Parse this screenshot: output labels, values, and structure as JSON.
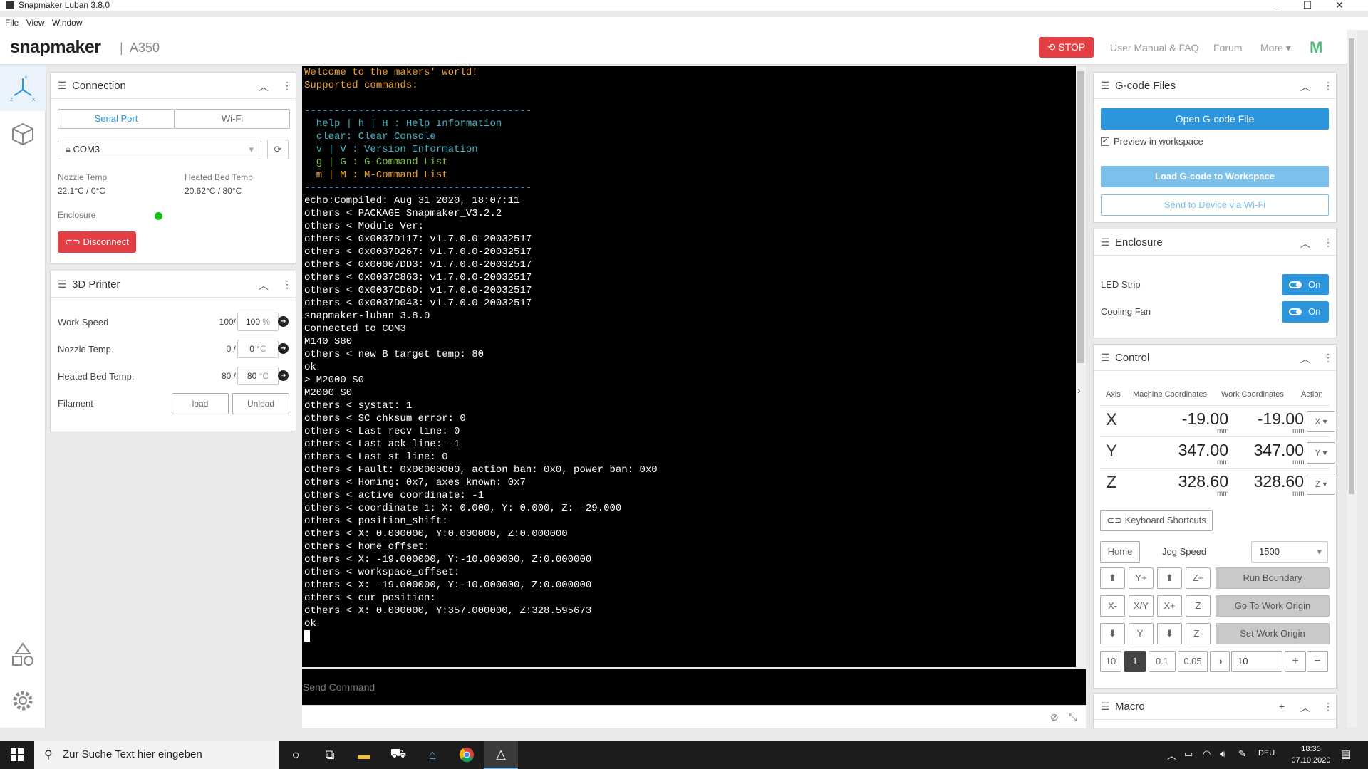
{
  "window": {
    "title": "Snapmaker Luban 3.8.0",
    "controls": [
      "–",
      "☐",
      "✕"
    ]
  },
  "menu": [
    "File",
    "View",
    "Window"
  ],
  "header": {
    "logo": "snapmaker",
    "separator": "|",
    "machine": "A350",
    "stop_label": "STOP",
    "links": [
      "User Manual & FAQ",
      "Forum",
      "More"
    ],
    "brand_mark": "M",
    "stop_color": "#e33f44"
  },
  "connection": {
    "title": "Connection",
    "tabs": [
      "Serial Port",
      "Wi-Fi"
    ],
    "port": "COM3",
    "nozzle_label": "Nozzle Temp",
    "nozzle_value": "22.1°C / 0°C",
    "bed_label": "Heated Bed Temp",
    "bed_value": "20.62°C / 80°C",
    "enclosure_label": "Enclosure",
    "disconnect_label": "Disconnect"
  },
  "printer": {
    "title": "3D Printer",
    "rows": [
      {
        "label": "Work Speed",
        "current": "100/",
        "target": "100",
        "unit": "%"
      },
      {
        "label": "Nozzle Temp.",
        "current": "0 /",
        "target": "0",
        "unit": "°C"
      },
      {
        "label": "Heated Bed Temp.",
        "current": "80 /",
        "target": "80",
        "unit": "°C"
      }
    ],
    "filament_label": "Filament",
    "load_label": "load",
    "unload_label": "Unload"
  },
  "console": {
    "lines": [
      {
        "text": "Welcome to the makers' world!",
        "color": "#f0a030"
      },
      {
        "text": "Supported commands:",
        "color": "#f0a030"
      },
      {
        "text": "",
        "color": "#fff"
      },
      {
        "text": "--------------------------------------",
        "color": "#3a8fd8"
      },
      {
        "text": "  help | h | H : Help Information",
        "color": "#3fb4c4"
      },
      {
        "text": "  clear: Clear Console",
        "color": "#3fb4c4"
      },
      {
        "text": "  v | V : Version Information",
        "color": "#3fb4c4"
      },
      {
        "text": "  g | G : G-Command List",
        "color": "#7dc242"
      },
      {
        "text": "  m | M : M-Command List",
        "color": "#f0a030"
      },
      {
        "text": "--------------------------------------",
        "color": "#3a8fd8"
      },
      {
        "text": "echo:Compiled: Aug 31 2020, 18:07:11",
        "color": "#fff"
      },
      {
        "text": "others < PACKAGE Snapmaker_V3.2.2",
        "color": "#fff"
      },
      {
        "text": "others < Module Ver:",
        "color": "#fff"
      },
      {
        "text": "others < 0x0037D117: v1.7.0.0-20032517",
        "color": "#fff"
      },
      {
        "text": "others < 0x0037D267: v1.7.0.0-20032517",
        "color": "#fff"
      },
      {
        "text": "others < 0x00007DD3: v1.7.0.0-20032517",
        "color": "#fff"
      },
      {
        "text": "others < 0x0037C863: v1.7.0.0-20032517",
        "color": "#fff"
      },
      {
        "text": "others < 0x0037CD6D: v1.7.0.0-20032517",
        "color": "#fff"
      },
      {
        "text": "others < 0x0037D043: v1.7.0.0-20032517",
        "color": "#fff"
      },
      {
        "text": "snapmaker-luban 3.8.0",
        "color": "#fff"
      },
      {
        "text": "Connected to COM3",
        "color": "#fff"
      },
      {
        "text": "M140 S80",
        "color": "#fff"
      },
      {
        "text": "others < new B target temp: 80",
        "color": "#fff"
      },
      {
        "text": "ok",
        "color": "#fff"
      },
      {
        "text": "> M2000 S0",
        "color": "#fff"
      },
      {
        "text": "M2000 S0",
        "color": "#fff"
      },
      {
        "text": "others < systat: 1",
        "color": "#fff"
      },
      {
        "text": "others < SC chksum error: 0",
        "color": "#fff"
      },
      {
        "text": "others < Last recv line: 0",
        "color": "#fff"
      },
      {
        "text": "others < Last ack line: -1",
        "color": "#fff"
      },
      {
        "text": "others < Last st line: 0",
        "color": "#fff"
      },
      {
        "text": "others < Fault: 0x00000000, action ban: 0x0, power ban: 0x0",
        "color": "#fff"
      },
      {
        "text": "others < Homing: 0x7, axes_known: 0x7",
        "color": "#fff"
      },
      {
        "text": "others < active coordinate: -1",
        "color": "#fff"
      },
      {
        "text": "others < coordinate 1: X: 0.000, Y: 0.000, Z: -29.000",
        "color": "#fff"
      },
      {
        "text": "others < position_shift:",
        "color": "#fff"
      },
      {
        "text": "others < X: 0.000000, Y:0.000000, Z:0.000000",
        "color": "#fff"
      },
      {
        "text": "others < home_offset:",
        "color": "#fff"
      },
      {
        "text": "others < X: -19.000000, Y:-10.000000, Z:0.000000",
        "color": "#fff"
      },
      {
        "text": "others < workspace_offset:",
        "color": "#fff"
      },
      {
        "text": "others < X: -19.000000, Y:-10.000000, Z:0.000000",
        "color": "#fff"
      },
      {
        "text": "others < cur position:",
        "color": "#fff"
      },
      {
        "text": "others < X: 0.000000, Y:357.000000, Z:328.595673",
        "color": "#fff"
      },
      {
        "text": "ok",
        "color": "#fff"
      }
    ],
    "send_placeholder": "Send Command"
  },
  "gcode": {
    "title": "G-code Files",
    "open_label": "Open G-code File",
    "preview_label": "Preview in workspace",
    "load_label": "Load G-code to Workspace",
    "send_label": "Send to Device via Wi-Fi"
  },
  "enclosure": {
    "title": "Enclosure",
    "rows": [
      {
        "label": "LED Strip",
        "state": "On"
      },
      {
        "label": "Cooling Fan",
        "state": "On"
      }
    ]
  },
  "control": {
    "title": "Control",
    "headers": [
      "Axis",
      "Machine Coordinates",
      "Work Coordinates",
      "Action"
    ],
    "axes": [
      {
        "axis": "X",
        "machine": "-19.00",
        "work": "-19.00",
        "unit": "mm",
        "action": "X"
      },
      {
        "axis": "Y",
        "machine": "347.00",
        "work": "347.00",
        "unit": "mm",
        "action": "Y"
      },
      {
        "axis": "Z",
        "machine": "328.60",
        "work": "328.60",
        "unit": "mm",
        "action": "Z"
      }
    ],
    "keyboard_label": "Keyboard Shortcuts",
    "home_label": "Home",
    "jog_speed_label": "Jog Speed",
    "jog_speed_value": "1500",
    "jog_row1": [
      "",
      "Y+",
      "",
      "Z+"
    ],
    "jog_row2": [
      "X-",
      "X/Y",
      "X+",
      "Z"
    ],
    "jog_row3": [
      "",
      "Y-",
      "",
      "Z-"
    ],
    "run_boundary": "Run Boundary",
    "go_origin": "Go To Work Origin",
    "set_origin": "Set Work Origin",
    "steps": [
      "10",
      "1",
      "0.1",
      "0.05"
    ],
    "custom_step": "10"
  },
  "macro": {
    "title": "Macro"
  },
  "taskbar": {
    "search_placeholder": "Zur Suche Text hier eingeben",
    "lang": "DEU",
    "time": "18:35",
    "date": "07.10.2020"
  }
}
